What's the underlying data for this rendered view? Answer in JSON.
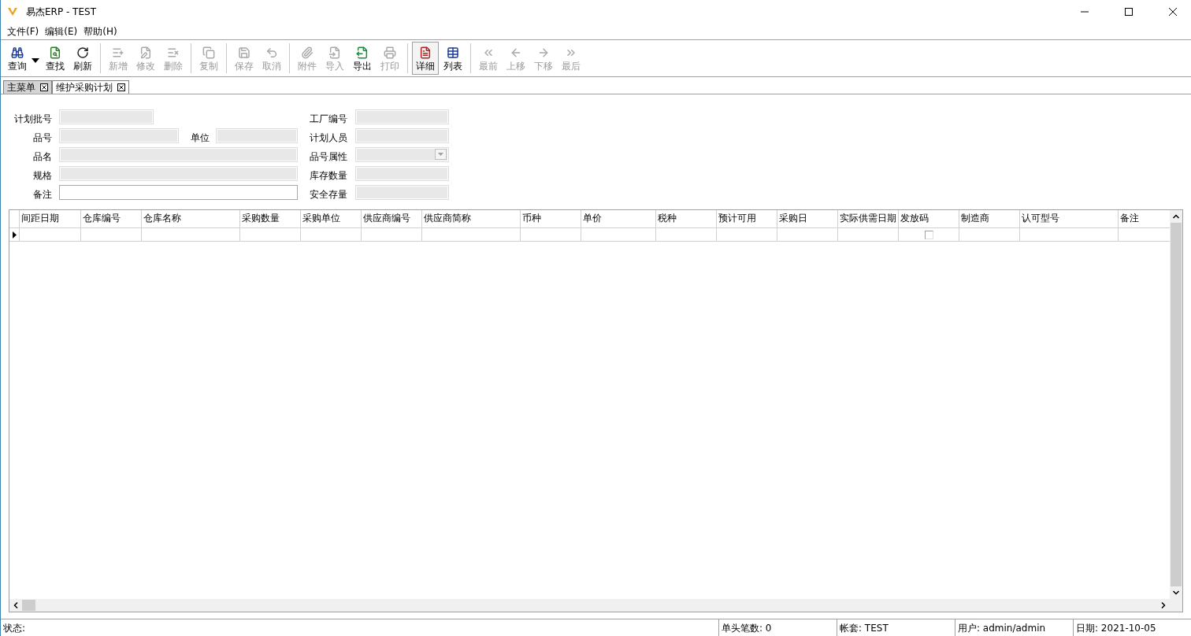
{
  "window": {
    "title": "易杰ERP - TEST"
  },
  "menu": [
    "文件(F)",
    "编辑(E)",
    "帮助(H)"
  ],
  "toolbar": {
    "groups": [
      {
        "buttons": [
          {
            "label": "查询",
            "disabled": false,
            "pressed": false,
            "menu": true
          },
          {
            "label": "查找",
            "disabled": false,
            "pressed": false,
            "menu": false
          },
          {
            "label": "刷新",
            "disabled": false,
            "pressed": false,
            "menu": false
          }
        ]
      },
      {
        "buttons": [
          {
            "label": "新增",
            "disabled": true,
            "pressed": false,
            "menu": false
          },
          {
            "label": "修改",
            "disabled": true,
            "pressed": false,
            "menu": false
          },
          {
            "label": "删除",
            "disabled": true,
            "pressed": false,
            "menu": false
          }
        ]
      },
      {
        "buttons": [
          {
            "label": "复制",
            "disabled": true,
            "pressed": false,
            "menu": false
          }
        ]
      },
      {
        "buttons": [
          {
            "label": "保存",
            "disabled": true,
            "pressed": false,
            "menu": false
          },
          {
            "label": "取消",
            "disabled": true,
            "pressed": false,
            "menu": false
          }
        ]
      },
      {
        "buttons": [
          {
            "label": "附件",
            "disabled": true,
            "pressed": false,
            "menu": false
          },
          {
            "label": "导入",
            "disabled": true,
            "pressed": false,
            "menu": false
          },
          {
            "label": "导出",
            "disabled": false,
            "pressed": false,
            "menu": false
          },
          {
            "label": "打印",
            "disabled": true,
            "pressed": false,
            "menu": false
          }
        ]
      },
      {
        "buttons": [
          {
            "label": "详细",
            "disabled": false,
            "pressed": true,
            "menu": false
          },
          {
            "label": "列表",
            "disabled": false,
            "pressed": false,
            "menu": false
          }
        ]
      },
      {
        "buttons": [
          {
            "label": "最前",
            "disabled": true,
            "pressed": false,
            "menu": false
          },
          {
            "label": "上移",
            "disabled": true,
            "pressed": false,
            "menu": false
          },
          {
            "label": "下移",
            "disabled": true,
            "pressed": false,
            "menu": false
          },
          {
            "label": "最后",
            "disabled": true,
            "pressed": false,
            "menu": false
          }
        ]
      }
    ]
  },
  "tabs": [
    {
      "label": "主菜单",
      "selected": false
    },
    {
      "label": "维护采购计划",
      "selected": true
    }
  ],
  "form": {
    "fields": [
      {
        "label": "计划批号",
        "kind": "text",
        "disabled": true
      },
      {
        "label": "工厂编号",
        "kind": "text",
        "disabled": true
      },
      {
        "label": "品号",
        "kind": "text",
        "disabled": true
      },
      {
        "label": "单位",
        "kind": "text",
        "disabled": true
      },
      {
        "label": "计划人员",
        "kind": "text",
        "disabled": true
      },
      {
        "label": "品名",
        "kind": "text",
        "disabled": true
      },
      {
        "label": "品号属性",
        "kind": "select",
        "disabled": true
      },
      {
        "label": "规格",
        "kind": "text",
        "disabled": true
      },
      {
        "label": "库存数量",
        "kind": "text",
        "disabled": true
      },
      {
        "label": "备注",
        "kind": "text",
        "disabled": false
      },
      {
        "label": "安全存量",
        "kind": "text",
        "disabled": true
      }
    ]
  },
  "table": {
    "columns": [
      {
        "label": "间距日期",
        "kind": "text"
      },
      {
        "label": "仓库编号",
        "kind": "text"
      },
      {
        "label": "仓库名称",
        "kind": "text"
      },
      {
        "label": "采购数量",
        "kind": "text"
      },
      {
        "label": "采购单位",
        "kind": "text"
      },
      {
        "label": "供应商编号",
        "kind": "text"
      },
      {
        "label": "供应商简称",
        "kind": "text"
      },
      {
        "label": "币种",
        "kind": "text"
      },
      {
        "label": "单价",
        "kind": "text"
      },
      {
        "label": "税种",
        "kind": "text"
      },
      {
        "label": "预计可用",
        "kind": "text"
      },
      {
        "label": "采购日",
        "kind": "text"
      },
      {
        "label": "实际供需日期",
        "kind": "text"
      },
      {
        "label": "发放码",
        "kind": "checkbox"
      },
      {
        "label": "制造商",
        "kind": "text"
      },
      {
        "label": "认可型号",
        "kind": "text"
      },
      {
        "label": "备注",
        "kind": "text"
      }
    ],
    "rows": [
      {
        "selected": true,
        "checked": false
      }
    ]
  },
  "status_bar": [
    "状态:",
    "单头笔数: 0",
    "帐套: TEST",
    "用户: admin/admin",
    "日期: 2021-10-05"
  ]
}
